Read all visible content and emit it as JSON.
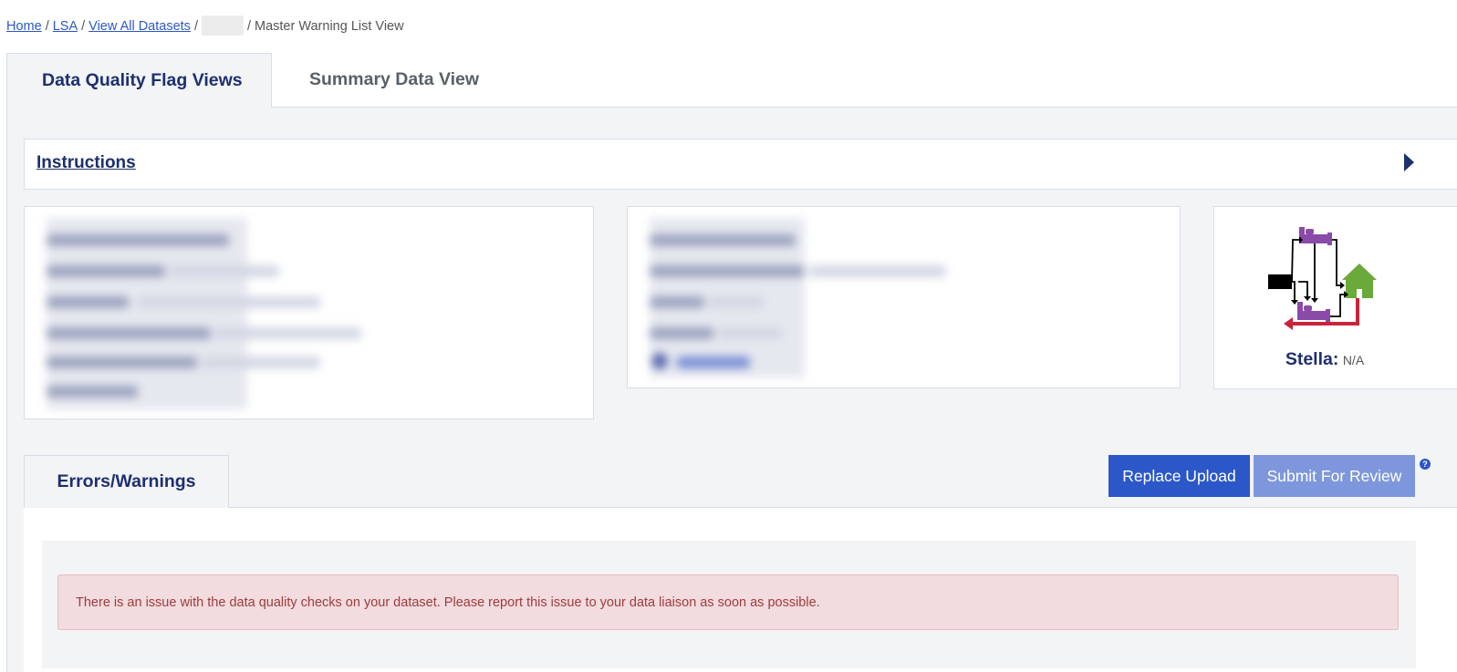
{
  "breadcrumb": {
    "home": "Home",
    "lsa": "LSA",
    "view_all": "View All Datasets",
    "separator": "/",
    "current": "Master Warning List View"
  },
  "tabs": {
    "quality": "Data Quality Flag Views",
    "summary": "Summary Data View"
  },
  "instructions": {
    "title": "Instructions"
  },
  "stella": {
    "label": "Stella:",
    "value": "N/A",
    "icon": "housing-flow-icon"
  },
  "subtabs": {
    "errors": "Errors/Warnings"
  },
  "actions": {
    "replace": "Replace Upload",
    "submit": "Submit For Review",
    "help": "?"
  },
  "alert": {
    "message": "There is an issue with the data quality checks on your dataset. Please report this issue to your data liaison as soon as possible."
  },
  "colors": {
    "primary": "#2b57c9",
    "navy": "#1d2f6f",
    "alert_bg": "#f2dcdf",
    "alert_text": "#a03b3b",
    "bed_purple": "#8a4aa8",
    "house_green": "#6aaa3a",
    "arrow_red": "#c8243c"
  }
}
